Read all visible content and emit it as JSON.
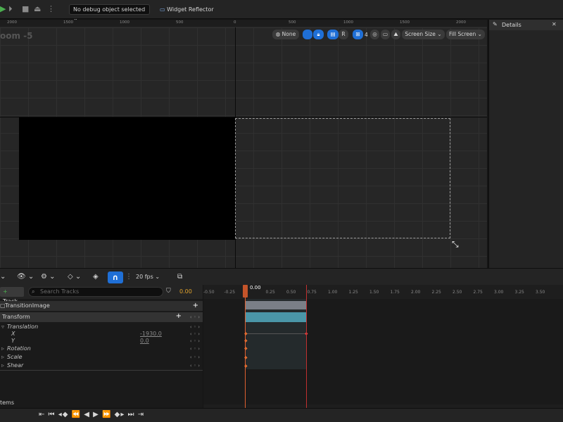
{
  "toolbar": {
    "debug_select": "No debug object selected",
    "widget_reflector": "Widget Reflector"
  },
  "ruler": {
    "labels": [
      "2000",
      "1500",
      "1000",
      "500",
      "0",
      "500",
      "1000",
      "1500",
      "2000"
    ]
  },
  "canvas": {
    "zoom_label": "oom -5",
    "none_btn": "None",
    "r_btn": "R",
    "grid_value": "4",
    "screen_size": "Screen Size",
    "fill_screen": "Fill Screen"
  },
  "details": {
    "title": "Details"
  },
  "sequencer": {
    "fps": "20 fps",
    "track_button": "Track",
    "search_placeholder": "Search Tracks",
    "time": "0.00",
    "playhead_time": "0.00",
    "items_label": "tems"
  },
  "outliner": {
    "widget": "TransitionImage",
    "transform": "Transform",
    "translation": "Translation",
    "x_label": "X",
    "x_value": "-1930.0",
    "y_label": "Y",
    "y_value": "0.0",
    "rotation": "Rotation",
    "scale": "Scale",
    "shear": "Shear"
  },
  "timeline": {
    "ticks": [
      "-0.50",
      "-0.25",
      "0.25",
      "0.50",
      "0.75",
      "1.00",
      "1.25",
      "1.50",
      "1.75",
      "2.00",
      "2.25",
      "2.50",
      "2.75",
      "3.00",
      "3.25",
      "3.50"
    ]
  }
}
